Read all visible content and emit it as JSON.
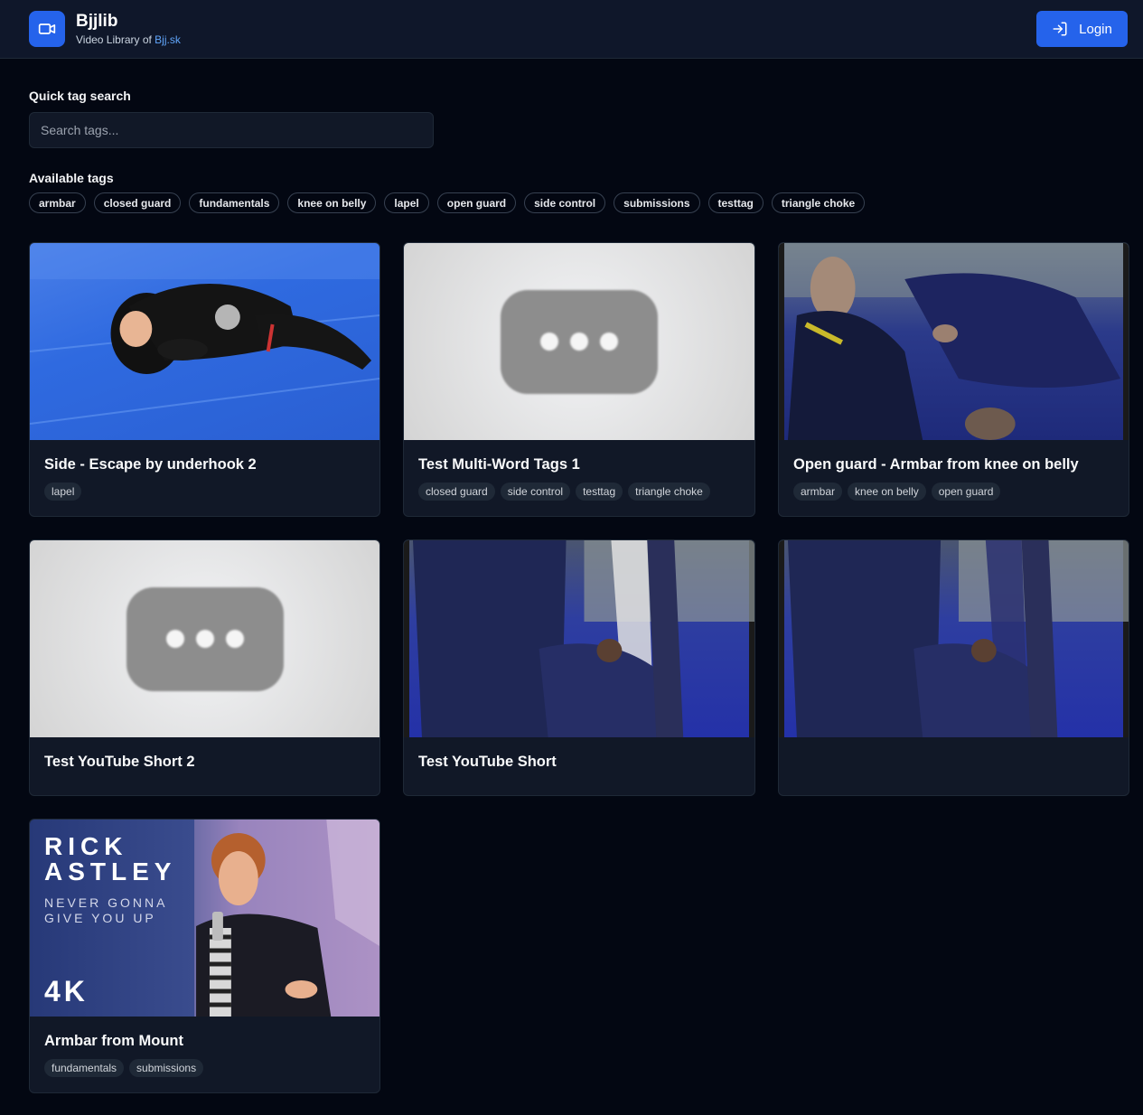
{
  "app": {
    "name": "Bjjlib",
    "subtitle_prefix": "Video Library of ",
    "subtitle_link": "Bjj.sk",
    "login_label": "Login"
  },
  "search": {
    "label": "Quick tag search",
    "placeholder": "Search tags..."
  },
  "tags": {
    "label": "Available tags",
    "items": [
      "armbar",
      "closed guard",
      "fundamentals",
      "knee on belly",
      "lapel",
      "open guard",
      "side control",
      "submissions",
      "testtag",
      "triangle choke"
    ]
  },
  "videos": [
    {
      "title": "Side - Escape by underhook 2",
      "tags": [
        "lapel"
      ],
      "thumb": "judo-mat-photo"
    },
    {
      "title": "Test Multi-Word Tags 1",
      "tags": [
        "closed guard",
        "side control",
        "testtag",
        "triangle choke"
      ],
      "thumb": "loading-placeholder"
    },
    {
      "title": "Open guard - Armbar from knee on belly",
      "tags": [
        "armbar",
        "knee on belly",
        "open guard"
      ],
      "thumb": "armbar-photo"
    },
    {
      "title": "Test YouTube Short 2",
      "tags": [],
      "thumb": "loading-placeholder"
    },
    {
      "title": "Test YouTube Short",
      "tags": [],
      "thumb": "guard-photo"
    },
    {
      "title": "",
      "tags": [],
      "thumb": "guard-photo"
    },
    {
      "title": "Armbar from Mount",
      "tags": [
        "fundamentals",
        "submissions"
      ],
      "thumb": "rick-astley-cover"
    }
  ],
  "rick_cover": {
    "line1": "RICK",
    "line2": "ASTLEY",
    "line3": "NEVER GONNA",
    "line4": "GIVE YOU UP",
    "badge": "4K"
  }
}
